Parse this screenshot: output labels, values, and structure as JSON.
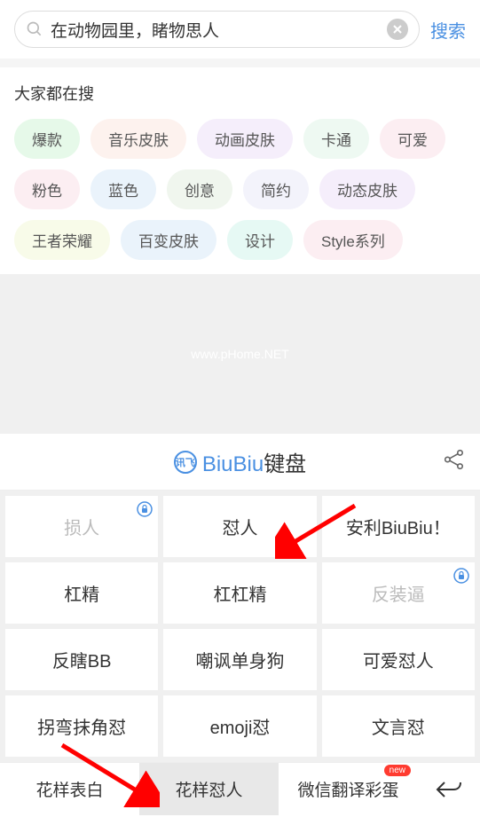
{
  "search": {
    "value": "在动物园里，睹物思人",
    "button": "搜索"
  },
  "hot": {
    "title": "大家都在搜",
    "tags": [
      {
        "label": "爆款",
        "bg": "#e6f9e9"
      },
      {
        "label": "音乐皮肤",
        "bg": "#fdf2ee"
      },
      {
        "label": "动画皮肤",
        "bg": "#f5eefb"
      },
      {
        "label": "卡通",
        "bg": "#eef9f2"
      },
      {
        "label": "可爱",
        "bg": "#fceef2"
      },
      {
        "label": "粉色",
        "bg": "#fceef2"
      },
      {
        "label": "蓝色",
        "bg": "#eaf3fb"
      },
      {
        "label": "创意",
        "bg": "#f0f6ee"
      },
      {
        "label": "简约",
        "bg": "#f3f3fb"
      },
      {
        "label": "动态皮肤",
        "bg": "#f5eefb"
      },
      {
        "label": "王者荣耀",
        "bg": "#f8fbe9"
      },
      {
        "label": "百变皮肤",
        "bg": "#eaf3fb"
      },
      {
        "label": "设计",
        "bg": "#e6f9f4"
      },
      {
        "label": "Style系列",
        "bg": "#fceef2"
      }
    ]
  },
  "watermark": "www.pHome.NET",
  "keyboard": {
    "title_prefix": "BiuBiu",
    "title_suffix": "键盘",
    "logo_text": "讯飞"
  },
  "phrases": [
    {
      "label": "损人",
      "locked": true
    },
    {
      "label": "怼人",
      "locked": false
    },
    {
      "label": "安利BiuBiu！",
      "locked": false
    },
    {
      "label": "杠精",
      "locked": false
    },
    {
      "label": "杠杠精",
      "locked": false
    },
    {
      "label": "反装逼",
      "locked": true
    },
    {
      "label": "反瞎BB",
      "locked": false
    },
    {
      "label": "嘲讽单身狗",
      "locked": false
    },
    {
      "label": "可爱怼人",
      "locked": false
    },
    {
      "label": "拐弯抹角怼",
      "locked": false
    },
    {
      "label": "emoji怼",
      "locked": false
    },
    {
      "label": "文言怼",
      "locked": false
    }
  ],
  "tabs": [
    {
      "label": "花样表白",
      "active": false,
      "new": false
    },
    {
      "label": "花样怼人",
      "active": true,
      "new": false
    },
    {
      "label": "微信翻译彩蛋",
      "active": false,
      "new": true
    }
  ],
  "new_badge": "new"
}
